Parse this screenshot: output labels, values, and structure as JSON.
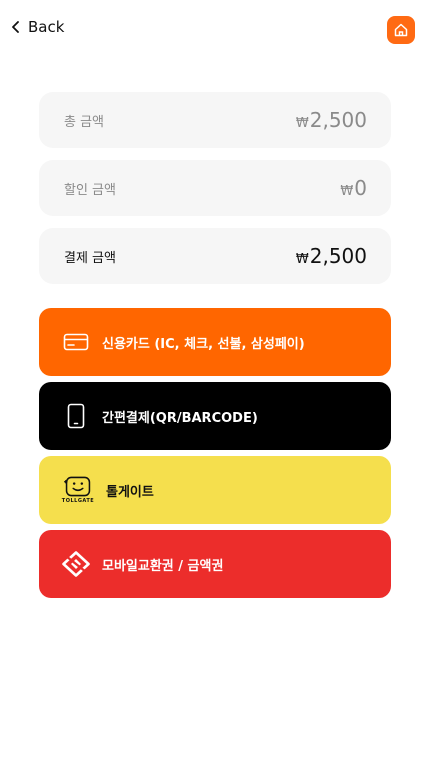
{
  "header": {
    "back_label": "Back"
  },
  "summary": {
    "currency_symbol": "₩",
    "rows": [
      {
        "label": "총 금액",
        "value": "2,500"
      },
      {
        "label": "할인 금액",
        "value": "0"
      },
      {
        "label": "결제 금액",
        "value": "2,500"
      }
    ]
  },
  "methods": [
    {
      "label": "신용카드 (IC, 체크, 선불, 삼성페이)",
      "color": "#ff6600"
    },
    {
      "label": "간편결제(QR/BARCODE)",
      "color": "#000000"
    },
    {
      "label": "톨게이트",
      "brand_text": "TOLLGATE",
      "color": "#f5df4d"
    },
    {
      "label": "모바일교환권 / 금액권",
      "color": "#ec2d2b"
    }
  ],
  "colors": {
    "accent": "#ff6a13",
    "surface": "#f6f6f6"
  }
}
